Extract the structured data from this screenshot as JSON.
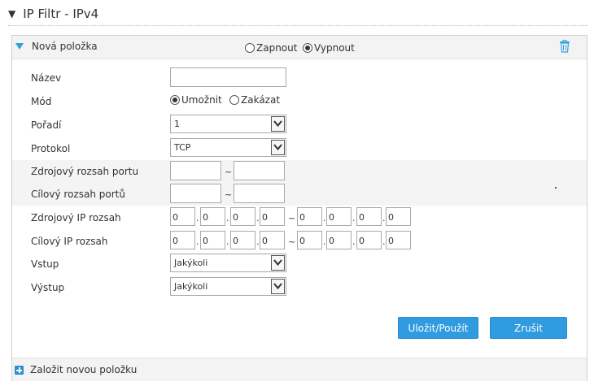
{
  "section": {
    "title": "IP Filtr - IPv4"
  },
  "header": {
    "title": "Nová položka",
    "radio_on": "Zapnout",
    "radio_off": "Vypnout",
    "selected": "off"
  },
  "form": {
    "name_label": "Název",
    "name_value": "",
    "mode_label": "Mód",
    "mode_allow": "Umožnit",
    "mode_deny": "Zakázat",
    "order_label": "Pořadí",
    "order_value": "1",
    "protocol_label": "Protokol",
    "protocol_value": "TCP",
    "src_port_label": "Zdrojový rozsah portu",
    "dst_port_label": "Cílový rozsah portů",
    "src_ip_label": "Zdrojový IP rozsah",
    "dst_ip_label": "Cílový IP rozsah",
    "src_ip_start": [
      "0",
      "0",
      "0",
      "0"
    ],
    "src_ip_end": [
      "0",
      "0",
      "0",
      "0"
    ],
    "dst_ip_start": [
      "0",
      "0",
      "0",
      "0"
    ],
    "dst_ip_end": [
      "0",
      "0",
      "0",
      "0"
    ],
    "in_label": "Vstup",
    "in_value": "Jakýkoli",
    "out_label": "Výstup",
    "out_value": "Jakýkoli",
    "tilde": "~",
    "dot": "."
  },
  "actions": {
    "save": "Uložit/Použít",
    "cancel": "Zrušit"
  },
  "footer": {
    "add_label": "Založit novou položku"
  },
  "colors": {
    "accent": "#2f9be0",
    "header_bg": "#f3f3f3"
  }
}
